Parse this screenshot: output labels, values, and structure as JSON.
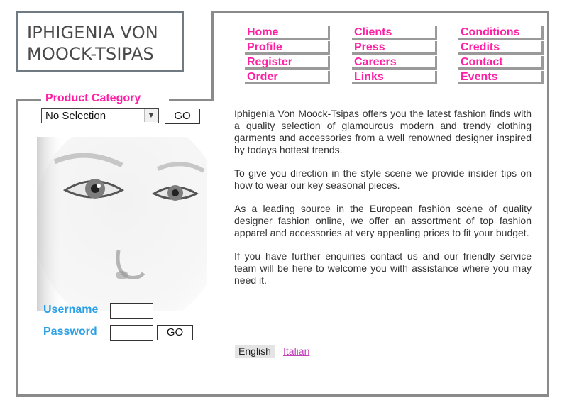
{
  "logo": {
    "line1": "IPHIGENIA VON",
    "line2": "MOOCK-TSIPAS"
  },
  "nav": {
    "col1": [
      "Home",
      "Profile",
      "Register",
      "Order"
    ],
    "col2": [
      "Clients",
      "Press",
      "Careers",
      "Links"
    ],
    "col3": [
      "Conditions",
      "Credits",
      "Contact",
      "Events"
    ]
  },
  "category": {
    "heading": "Product Category",
    "selected": "No Selection",
    "go_label": "GO"
  },
  "login": {
    "username_label": "Username",
    "password_label": "Password",
    "go_label": "GO"
  },
  "content": {
    "paragraphs": [
      "Iphigenia Von Moock-Tsipas offers you the latest fashion finds with a quality selection of glamourous modern and trendy clothing garments and accessories from a well renowned designer inspired by todays hottest trends.",
      "To give you direction in the style scene we provide insider tips on how to wear our key seasonal pieces.",
      "As a leading source in the European fashion scene of quality designer fashion online, we offer an assortment of top fashion apparel and accessories at very appealing prices to fit your budget.",
      "If you have further enquiries contact us and our friendly service team will be here to welcome you with assistance where you may need it."
    ]
  },
  "languages": {
    "current": "English",
    "other": "Italian"
  },
  "colors": {
    "accent": "#ff1fa5",
    "login_label": "#2aa0e6",
    "frame": "#8a8a8a",
    "link": "#c23fb8"
  }
}
